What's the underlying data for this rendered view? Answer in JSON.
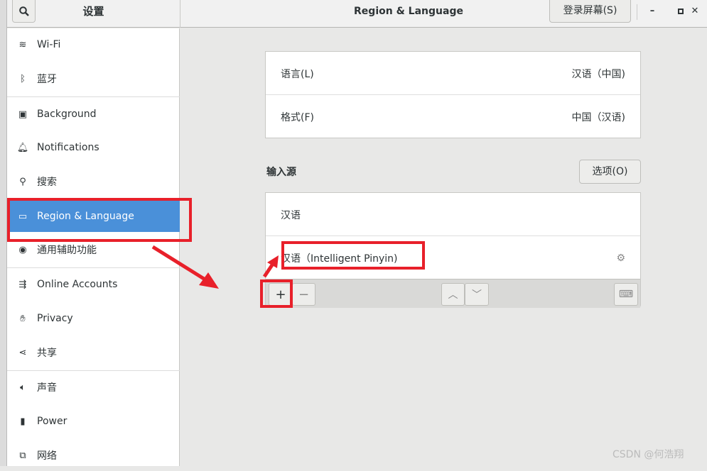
{
  "header": {
    "sidebar_title": "设置",
    "title": "Region & Language",
    "login_screen_button": "登录屏幕(S)",
    "minimize": "–",
    "maximize": "▫",
    "close": "✕"
  },
  "sidebar": {
    "items": [
      {
        "label": "Wi-Fi",
        "icon": "wifi-icon"
      },
      {
        "label": "蓝牙",
        "icon": "bluetooth-icon"
      },
      {
        "label": "Background",
        "icon": "background-icon"
      },
      {
        "label": "Notifications",
        "icon": "bell-icon"
      },
      {
        "label": "搜索",
        "icon": "search-icon"
      },
      {
        "label": "Region & Language",
        "icon": "region-icon",
        "selected": true
      },
      {
        "label": "通用辅助功能",
        "icon": "accessibility-icon"
      },
      {
        "label": "Online Accounts",
        "icon": "online-accounts-icon"
      },
      {
        "label": "Privacy",
        "icon": "hand-icon"
      },
      {
        "label": "共享",
        "icon": "share-icon"
      },
      {
        "label": "声音",
        "icon": "speaker-icon"
      },
      {
        "label": "Power",
        "icon": "power-icon"
      },
      {
        "label": "网络",
        "icon": "network-icon"
      }
    ]
  },
  "main": {
    "language": {
      "label": "语言(L)",
      "value": "汉语（中国)"
    },
    "formats": {
      "label": "格式(F)",
      "value": "中国（汉语)"
    },
    "input_sources": {
      "title": "输入源",
      "options_button": "选项(O)",
      "sources": [
        "汉语",
        "汉语（Intelligent Pinyin)"
      ],
      "add": "+",
      "remove": "−"
    }
  },
  "watermark": "CSDN @何浩翔",
  "colors": {
    "selected": "#4a90d9",
    "annotation": "#e8202a"
  }
}
